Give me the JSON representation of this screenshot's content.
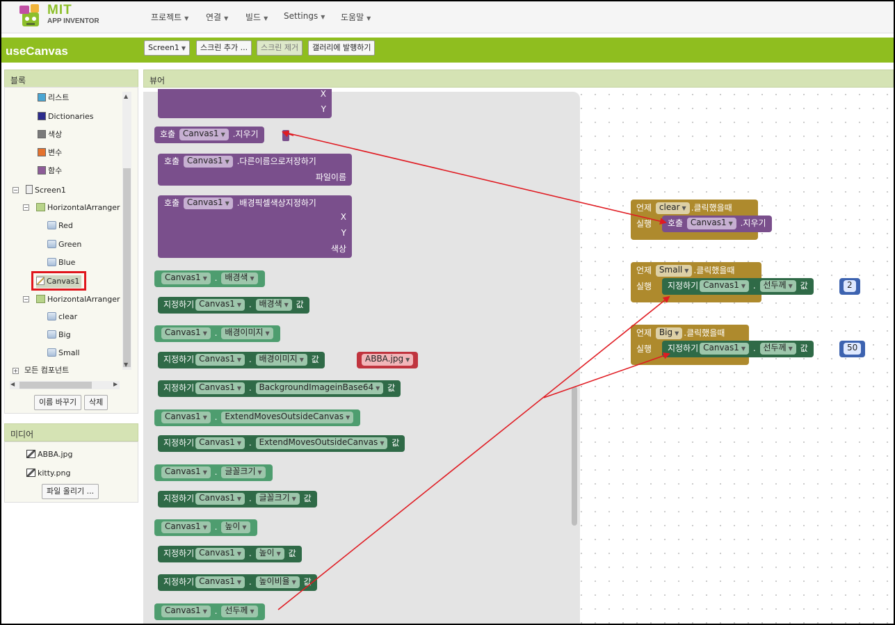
{
  "app": {
    "logo_mit": "MIT",
    "logo_sub": "APP INVENTOR"
  },
  "menu": [
    "프로젝트",
    "연결",
    "빌드",
    "Settings",
    "도움말"
  ],
  "project": {
    "title": "useCanvas"
  },
  "toolbar": {
    "screen_btn": "Screen1",
    "add_screen": "스크린 추가 ...",
    "remove_screen": "스크린 제거",
    "publish": "갤러리에 발행하기"
  },
  "blocks_panel": {
    "header": "블록",
    "builtins": [
      {
        "label": "리스트",
        "color": "#4aa6d3"
      },
      {
        "label": "Dictionaries",
        "color": "#2b2b8c"
      },
      {
        "label": "색상",
        "color": "#7a7a7a"
      },
      {
        "label": "변수",
        "color": "#e4722e"
      },
      {
        "label": "함수",
        "color": "#8d5c98"
      }
    ],
    "screen": "Screen1",
    "arr1": "HorizontalArranger",
    "arr1_children": [
      "Red",
      "Green",
      "Blue"
    ],
    "canvas": "Canvas1",
    "arr2": "HorizontalArranger",
    "arr2_children": [
      "clear",
      "Big",
      "Small"
    ],
    "all_components": "모든 컴포넌트",
    "rename_btn": "이름 바꾸기",
    "delete_btn": "삭제"
  },
  "media_panel": {
    "header": "미디어",
    "files": [
      "ABBA.jpg",
      "kitty.png"
    ],
    "upload_btn": "파일 올리기 ..."
  },
  "viewer": {
    "header": "뷰어"
  },
  "flyout": {
    "x": "X",
    "y": "Y",
    "call": "호출",
    "set": "지정하기",
    "val": "값",
    "dot": ".",
    "comp": "Canvas1",
    "clear": ".지우기",
    "save_as": ".다른이름으로저장하기",
    "filename": "파일이름",
    "set_bg_pixel": ".배경픽셀색상지정하기",
    "color": "색상",
    "p_bgcolor": "배경색",
    "p_bgimage": "배경이미지",
    "abba": "ABBA.jpg",
    "p_bgbase64": "BackgroundImageinBase64",
    "p_extend": "ExtendMovesOutsideCanvas",
    "p_fontsize": "글꼴크기",
    "p_height": "높이",
    "p_height_pct": "높이비율",
    "p_linewidth": "선두께"
  },
  "workspace": {
    "when": "언제",
    "do": "실행",
    "clicked": ".클릭했을때",
    "call": "호출",
    "set": "지정하기",
    "val": "값",
    "dot": ".",
    "comp": "Canvas1",
    "clear_method": ".지우기",
    "linewidth": "선두께",
    "ev1_btn": "clear",
    "ev2_btn": "Small",
    "ev2_val": "2",
    "ev3_btn": "Big",
    "ev3_val": "50"
  },
  "colors": {
    "accent_green": "#8fbe1f",
    "highlight_red": "#e0161d",
    "arrow_red": "#e01b22"
  }
}
